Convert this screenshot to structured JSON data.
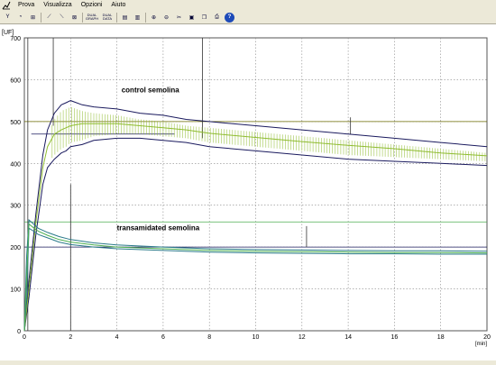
{
  "menu": {
    "items": [
      "Prova",
      "Visualizza",
      "Opzioni",
      "Aiuto"
    ]
  },
  "toolbar": {
    "buttons": [
      {
        "name": "filter-icon",
        "glyph": "Y"
      },
      {
        "name": "refresh-icon",
        "glyph": "◔"
      },
      {
        "name": "scale-icon",
        "glyph": "⊞"
      },
      {
        "name": "chart-line-icon",
        "glyph": "⟋"
      },
      {
        "name": "chart-down-icon",
        "glyph": "⟍"
      },
      {
        "name": "settings-chart-icon",
        "glyph": "⊠"
      },
      {
        "name": "dual-mode-icon",
        "glyph": "",
        "wide": true,
        "lines": [
          "DUAL",
          "GRAPH"
        ]
      },
      {
        "name": "dual-data-icon",
        "glyph": "",
        "wide": true,
        "lines": [
          "DUAL",
          "DATA"
        ]
      },
      {
        "name": "grid-h-icon",
        "glyph": "▤"
      },
      {
        "name": "grid-v-icon",
        "glyph": "▥"
      },
      {
        "name": "zoom-in-icon",
        "glyph": "⊕"
      },
      {
        "name": "zoom-out-icon",
        "glyph": "⊖"
      },
      {
        "name": "cut-icon",
        "glyph": "✂"
      },
      {
        "name": "export-icon",
        "glyph": "▣"
      },
      {
        "name": "copy-icon",
        "glyph": "❐"
      },
      {
        "name": "print-icon",
        "glyph": "⎙"
      },
      {
        "name": "help-icon",
        "glyph": "?"
      }
    ]
  },
  "colors": {
    "dark_line": "#1a1a5e",
    "green_line": "#8fbc30",
    "teal_line": "#2a7a8a",
    "target_line": "#6b6b00",
    "ref_line": "#4caf50"
  },
  "chart_data": {
    "type": "line",
    "ylabel": "[UF]",
    "xlabel": "[min]",
    "xlim": [
      0,
      20
    ],
    "ylim": [
      0,
      700
    ],
    "xticks": [
      "0",
      "2",
      "4",
      "6",
      "8",
      "10",
      "12",
      "14",
      "16",
      "18",
      "20"
    ],
    "yticks": [
      "0",
      "100",
      "200",
      "300",
      "400",
      "500",
      "600",
      "700"
    ],
    "grid": true,
    "annotations": [
      "control semolina",
      "transamidated semolina"
    ],
    "reference_lines": [
      500,
      470,
      260,
      200
    ],
    "series": [
      {
        "x": [
          0,
          0.2,
          0.5,
          0.8,
          1,
          1.3,
          1.6,
          1.8,
          2,
          2.5,
          3,
          4,
          5,
          6,
          7,
          8,
          10,
          12,
          14,
          16,
          18,
          20
        ],
        "upper": [
          0,
          120,
          280,
          420,
          480,
          520,
          540,
          545,
          550,
          540,
          535,
          530,
          520,
          515,
          505,
          500,
          490,
          480,
          470,
          460,
          450,
          440
        ],
        "lower": [
          0,
          80,
          230,
          350,
          390,
          410,
          425,
          430,
          440,
          445,
          455,
          460,
          460,
          455,
          450,
          440,
          430,
          420,
          410,
          405,
          400,
          395
        ],
        "mean": [
          0,
          100,
          260,
          390,
          440,
          470,
          480,
          485,
          490,
          495,
          495,
          495,
          490,
          485,
          480,
          472,
          462,
          452,
          443,
          435,
          425,
          418
        ]
      },
      {
        "x": [
          0,
          0.1,
          0.2,
          0.4,
          0.6,
          1,
          1.5,
          2,
          3,
          4,
          6,
          8,
          10,
          12,
          14,
          16,
          18,
          20
        ],
        "upper": [
          0,
          180,
          265,
          255,
          245,
          235,
          225,
          218,
          210,
          205,
          200,
          196,
          194,
          193,
          192,
          191,
          191,
          190
        ],
        "lower": [
          0,
          80,
          245,
          238,
          230,
          222,
          212,
          206,
          200,
          196,
          192,
          188,
          186,
          185,
          184,
          184,
          183,
          183
        ],
        "mean": [
          0,
          130,
          255,
          246,
          238,
          228,
          218,
          212,
          205,
          200,
          196,
          192,
          190,
          189,
          188,
          187,
          187,
          186
        ]
      }
    ]
  }
}
